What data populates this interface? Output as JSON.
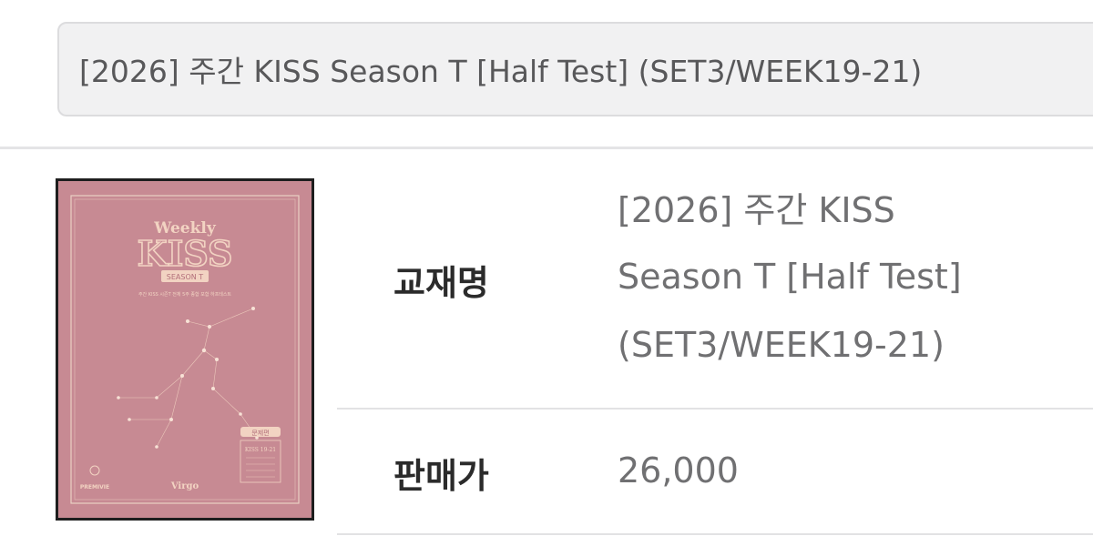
{
  "title_field": {
    "value": "[2026] 주간 KISS Season T [Half Test] (SET3/WEEK19-21)"
  },
  "cover": {
    "top_word": "Weekly",
    "main_word": "KISS",
    "badge": "SEASON T",
    "subtitle": "주간 KISS 시즌T 전체 5주 종합 포함 하프테스트",
    "side_badge": "문제편",
    "side_title": "KISS 19-21",
    "constellation": "Virgo",
    "publisher": "PREMIVIE",
    "colors": {
      "background": "#c78a93",
      "gold": "#f2d3c2"
    }
  },
  "details": {
    "name_label": "교재명",
    "name_lines": [
      "[2026] 주간 KISS",
      "Season T [Half Test]",
      "(SET3/WEEK19-21)"
    ],
    "price_label": "판매가",
    "price_value": "26,000"
  }
}
